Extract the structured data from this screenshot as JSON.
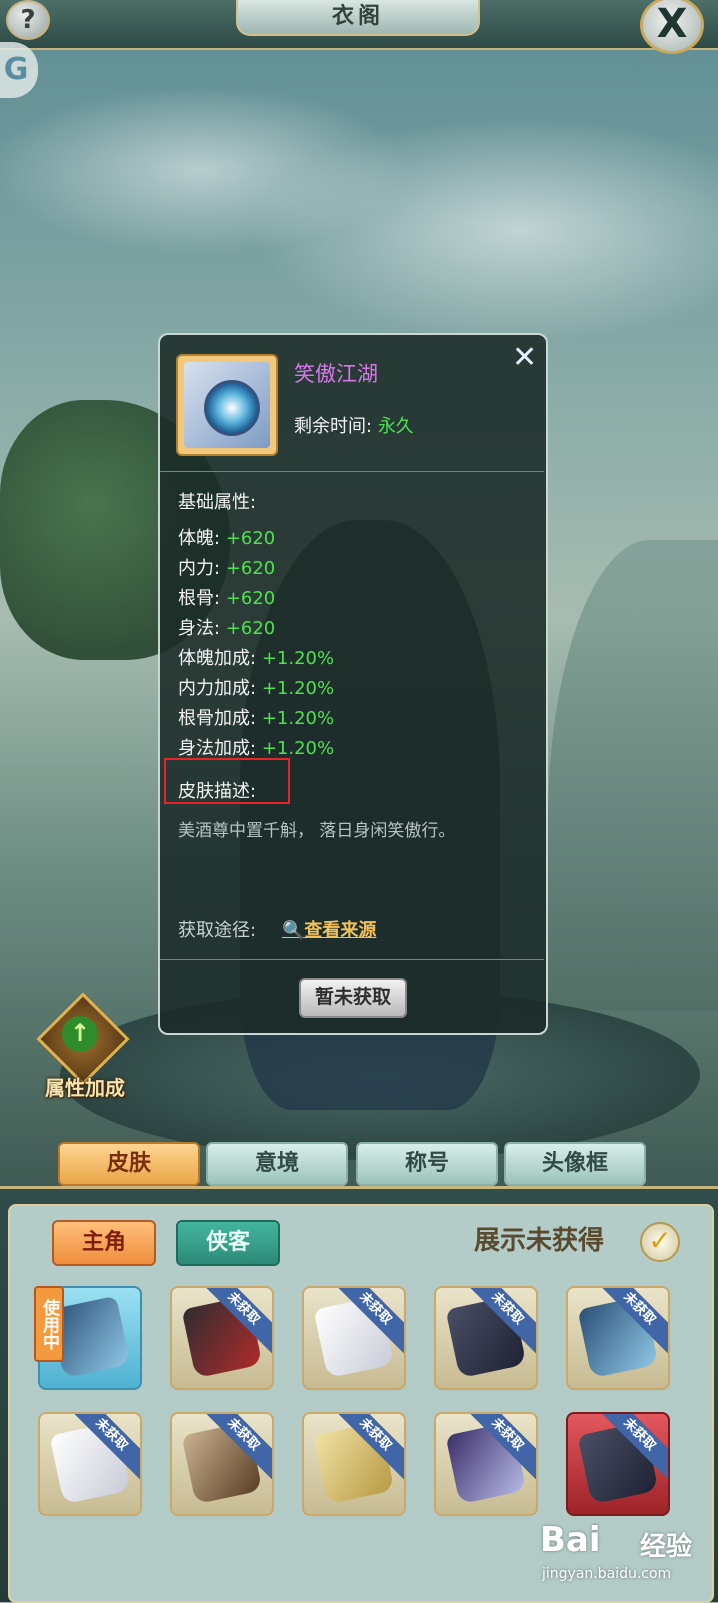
{
  "window": {
    "title": "衣阁"
  },
  "top": {
    "help_icon": "?",
    "close_icon": "X",
    "side_icon": "G"
  },
  "attr_bonus": {
    "label": "属性加成",
    "icon": "up-arrow-icon"
  },
  "popup": {
    "item_name": "笑傲江湖",
    "time_label": "剩余时间:",
    "time_value": "永久",
    "base_title": "基础属性:",
    "stats": [
      {
        "label": "体魄:",
        "value": "+620"
      },
      {
        "label": "内力:",
        "value": "+620"
      },
      {
        "label": "根骨:",
        "value": "+620"
      },
      {
        "label": "身法:",
        "value": "+620"
      },
      {
        "label": "体魄加成:",
        "value": "+1.20%"
      },
      {
        "label": "内力加成:",
        "value": "+1.20%"
      },
      {
        "label": "根骨加成:",
        "value": "+1.20%"
      },
      {
        "label": "身法加成:",
        "value": "+1.20%"
      }
    ],
    "desc_title": "皮肤描述:",
    "desc_text": "美酒尊中置千斛， 落日身闲笑傲行。",
    "source_label": "获取途径:",
    "source_link": "查看来源",
    "button": "暂未获取",
    "close": "✕",
    "colors": {
      "name": "#d877ea",
      "value": "#4fe04f",
      "highlight": "#e8242a"
    }
  },
  "tabs": [
    {
      "label": "皮肤",
      "active": true
    },
    {
      "label": "意境",
      "active": false
    },
    {
      "label": "称号",
      "active": false
    },
    {
      "label": "头像框",
      "active": false
    }
  ],
  "panel": {
    "sub_tabs": [
      "主角",
      "侠客"
    ],
    "show_unowned": "展示未获得",
    "in_use": "使用中",
    "ribbon": "未获取"
  },
  "watermark": {
    "logo": "Bai",
    "text": "经验",
    "url": "jingyan.baidu.com"
  }
}
